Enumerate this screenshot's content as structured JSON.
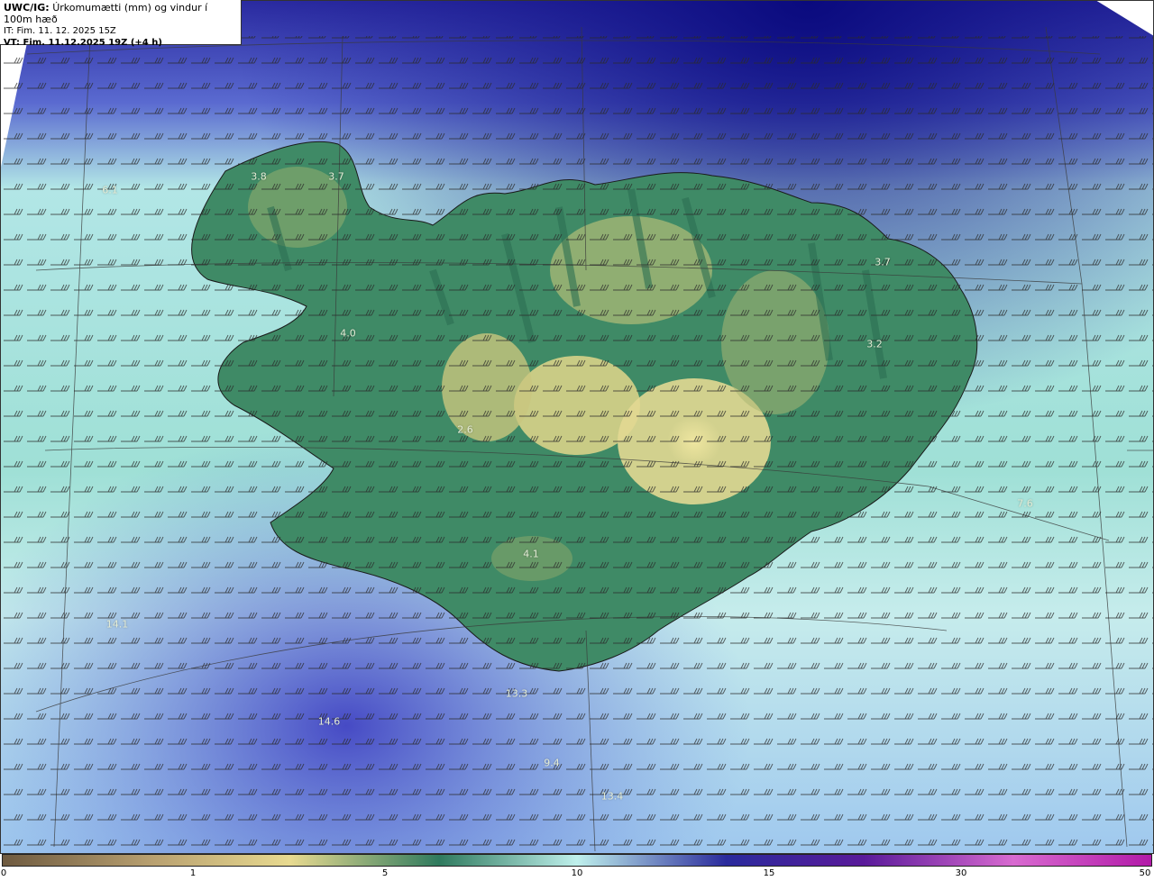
{
  "header": {
    "model_label": "UWC/IG:",
    "title": "Úrkomumætti (mm) og vindur í 100m hæð",
    "it_line": "IT: Fim. 11. 12. 2025 15Z",
    "vt_line": "VT: Fim. 11.12.2025 19Z (+4 h)"
  },
  "value_labels": [
    {
      "text": "3.8"
    },
    {
      "text": "3.7"
    },
    {
      "text": "6.1"
    },
    {
      "text": "3.7"
    },
    {
      "text": "4.0"
    },
    {
      "text": "3.2"
    },
    {
      "text": "2.6"
    },
    {
      "text": "4.1"
    },
    {
      "text": "7.6"
    },
    {
      "text": "14.1"
    },
    {
      "text": "14.6"
    },
    {
      "text": "13.3"
    },
    {
      "text": "9.4"
    },
    {
      "text": "13.4"
    }
  ],
  "colorbar": {
    "ticks": [
      "0",
      "1",
      "5",
      "10",
      "15",
      "30",
      "50"
    ],
    "colors": [
      "#6e5a40",
      "#b8a070",
      "#e8da90",
      "#2f7a5e",
      "#bff0ec",
      "#2a2a9c",
      "#5a1a9a",
      "#d86ad0",
      "#b21aa8"
    ]
  },
  "colors": {
    "ocean_high": "#1a1a90",
    "ocean_mid": "#6a7ad0",
    "ocean_light": "#bdeee9",
    "land_green": "#3f8a66",
    "land_yellow": "#d4d28a"
  }
}
